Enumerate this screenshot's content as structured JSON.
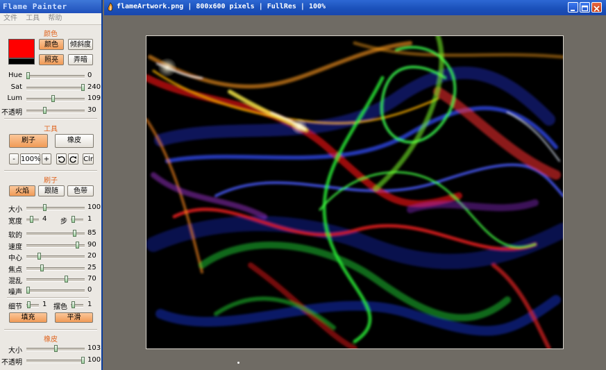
{
  "panel": {
    "title": "Flame Painter",
    "menu": [
      "文件",
      "工具",
      "帮助"
    ],
    "color_section": {
      "title": "颜色",
      "primary_color": "#ff0000",
      "secondary_color": "#000000",
      "buttons": [
        "颜色",
        "倾斜度",
        "照亮",
        "弄暗"
      ],
      "sliders": [
        {
          "label": "Hue",
          "value": "0",
          "fraction": 0.0
        },
        {
          "label": "Sat",
          "value": "240",
          "fraction": 1.0
        },
        {
          "label": "Lum",
          "value": "109",
          "fraction": 0.45
        },
        {
          "label": "不透明",
          "value": "30",
          "fraction": 0.3
        }
      ]
    },
    "tools_section": {
      "title": "工具",
      "brush_button": "刷子",
      "eraser_button": "橡皮",
      "zoom_minus": "-",
      "zoom_value": "100%",
      "zoom_plus": "+",
      "undo_icon": "undo-icon",
      "redo_icon": "redo-icon",
      "clear_button": "Clr"
    },
    "brush_section": {
      "title": "刷子",
      "modes": [
        "火焰",
        "跟随",
        "色带"
      ],
      "size": {
        "label": "大小",
        "value": "100",
        "fraction": 0.3
      },
      "width": {
        "label": "宽度",
        "value": "4",
        "fraction": 0.4
      },
      "step": {
        "label": "步",
        "value": "1",
        "fraction": 0.1
      },
      "sliders": [
        {
          "label": "软的",
          "value": "85",
          "fraction": 0.85
        },
        {
          "label": "速度",
          "value": "90",
          "fraction": 0.9
        },
        {
          "label": "中心",
          "value": "20",
          "fraction": 0.2
        },
        {
          "label": "焦点",
          "value": "25",
          "fraction": 0.25
        },
        {
          "label": "混乱",
          "value": "70",
          "fraction": 0.7
        },
        {
          "label": "噪声",
          "value": "0",
          "fraction": 0.0
        }
      ],
      "detail": {
        "label": "细节",
        "value": "1",
        "fraction": 0.05
      },
      "hue_shift": {
        "label": "摆色",
        "value": "1",
        "fraction": 0.05
      },
      "fill_button": "填充",
      "smooth_button": "平滑"
    },
    "eraser_section": {
      "title": "橡皮",
      "sliders": [
        {
          "label": "大小",
          "value": "103",
          "fraction": 0.5
        },
        {
          "label": "不透明",
          "value": "100",
          "fraction": 1.0
        }
      ]
    }
  },
  "image_window": {
    "title": "flameArtwork.png | 800x600 pixels | FullRes | 100%",
    "app_icon": "flame-icon",
    "controls": [
      "minimize-icon",
      "maximize-icon",
      "close-icon"
    ]
  },
  "colors": {
    "accent": "#e0651f",
    "titlebar": "#1f50bb",
    "workspace": "#6f6b64"
  }
}
